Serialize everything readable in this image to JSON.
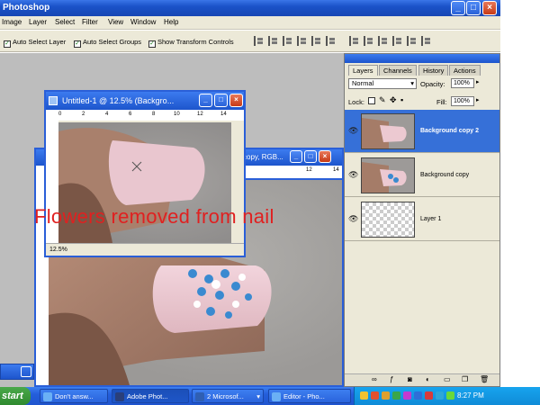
{
  "app": {
    "title": "Photoshop"
  },
  "menu": [
    "Image",
    "Layer",
    "Select",
    "Filter",
    "View",
    "Window",
    "Help"
  ],
  "options": {
    "auto_select_layer": "Auto Select Layer",
    "auto_select_groups": "Auto Select Groups",
    "show_transform_controls": "Show Transform Controls"
  },
  "doc_front": {
    "title": "Untitled-1 @ 12.5% (Backgro...",
    "zoom": "12.5%",
    "ruler_marks": [
      "0",
      "2",
      "4",
      "6",
      "8",
      "10",
      "12",
      "14"
    ]
  },
  "doc_back": {
    "title": "copy, RGB...",
    "ruler_marks": [
      "12",
      "14"
    ]
  },
  "annotation": "Flowers removed from nail",
  "layers_panel": {
    "tabs": [
      "Layers",
      "Channels",
      "History",
      "Actions"
    ],
    "blend_mode": "Normal",
    "opacity_label": "Opacity:",
    "opacity_value": "100%",
    "lock_label": "Lock:",
    "fill_label": "Fill:",
    "fill_value": "100%",
    "layers": [
      {
        "name": "Background copy 2",
        "selected": true
      },
      {
        "name": "Background copy",
        "selected": false
      },
      {
        "name": "Layer 1",
        "selected": false
      }
    ]
  },
  "taskbar": {
    "start": "start",
    "tasks": [
      "Don't answ...",
      "Adobe Phot...",
      "2 Microsof...",
      "Editor - Pho..."
    ],
    "clock": "8:27 PM"
  },
  "colors": {
    "accent": "#245edb",
    "annotation": "#e02020",
    "selection": "#3670d8"
  }
}
